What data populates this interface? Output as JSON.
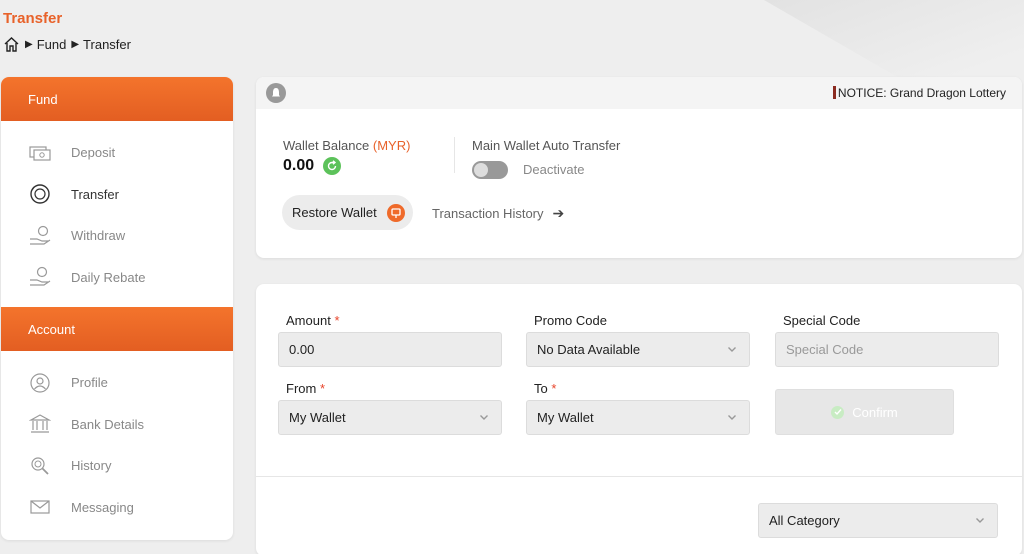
{
  "page": {
    "title": "Transfer",
    "breadcrumb": [
      "Fund",
      "Transfer"
    ]
  },
  "sidebar": {
    "groups": [
      {
        "header": "Fund",
        "items": [
          {
            "label": "Deposit",
            "icon": "deposit-icon"
          },
          {
            "label": "Transfer",
            "icon": "transfer-icon",
            "active": true
          },
          {
            "label": "Withdraw",
            "icon": "withdraw-icon"
          },
          {
            "label": "Daily Rebate",
            "icon": "rebate-icon"
          }
        ]
      },
      {
        "header": "Account",
        "items": [
          {
            "label": "Profile",
            "icon": "profile-icon"
          },
          {
            "label": "Bank Details",
            "icon": "bank-icon"
          },
          {
            "label": "History",
            "icon": "history-icon"
          },
          {
            "label": "Messaging",
            "icon": "mail-icon"
          }
        ]
      }
    ]
  },
  "wallet": {
    "notice": "NOTICE: Grand Dragon Lottery",
    "balance_label": "Wallet Balance",
    "currency": "(MYR)",
    "balance": "0.00",
    "auto_transfer_label": "Main Wallet Auto Transfer",
    "auto_transfer_state": "Deactivate",
    "restore_label": "Restore Wallet",
    "history_link": "Transaction History"
  },
  "form": {
    "amount_label": "Amount",
    "amount_value": "0.00",
    "promo_label": "Promo Code",
    "promo_value": "No Data Available",
    "special_label": "Special Code",
    "special_placeholder": "Special Code",
    "from_label": "From",
    "from_value": "My Wallet",
    "to_label": "To",
    "to_value": "My Wallet",
    "required_mark": "*",
    "confirm_label": "Confirm",
    "category_value": "All Category"
  },
  "colors": {
    "accent": "#e8622a",
    "success": "#5cc25a"
  }
}
